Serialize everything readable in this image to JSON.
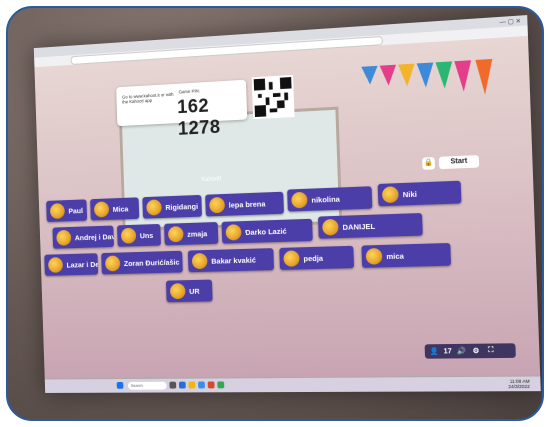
{
  "window": {
    "controls": "— ▢ ✕"
  },
  "join": {
    "instructions": "Go to www.kahoot.it or with the Kahoot! app",
    "pin_label": "Game PIN:",
    "pin": "162 1278"
  },
  "lobby": {
    "title": "Kahoot!"
  },
  "start_label": "Start",
  "players": [
    {
      "name": "Paul",
      "avatar": "bird-avatar-icon"
    },
    {
      "name": "Mica",
      "avatar": "cat-avatar-icon"
    },
    {
      "name": "Rigidangi",
      "avatar": "owl-avatar-icon"
    },
    {
      "name": "lepa brena",
      "avatar": "fox-avatar-icon"
    },
    {
      "name": "nikolina",
      "avatar": "king-avatar-icon"
    },
    {
      "name": "Niki",
      "avatar": "fox-avatar-icon"
    },
    {
      "name": "Andrej i David",
      "avatar": "owl-avatar-icon"
    },
    {
      "name": "Uns",
      "avatar": "cat-avatar-icon"
    },
    {
      "name": "zmaja",
      "avatar": "owl-avatar-icon"
    },
    {
      "name": "Darko Lazić",
      "avatar": "monkey-avatar-icon"
    },
    {
      "name": "DANIJEL",
      "avatar": "headphones-avatar-icon"
    },
    {
      "name": "Lazar i De",
      "avatar": "king-avatar-icon"
    },
    {
      "name": "Zoran Đurić/ašic",
      "avatar": "bird-avatar-icon"
    },
    {
      "name": "Bakar kvakić",
      "avatar": "duck-avatar-icon"
    },
    {
      "name": "pedja",
      "avatar": "dog-avatar-icon"
    },
    {
      "name": "mica",
      "avatar": "penguin-avatar-icon"
    },
    {
      "name": "UR",
      "avatar": "cat-avatar-icon"
    }
  ],
  "player_count": "17",
  "taskbar": {
    "search": "Search",
    "time": "11:08 AM",
    "date": "24/3/2022"
  },
  "colors": {
    "player_tile": "#4b3ea8",
    "pin_text": "#222222"
  }
}
